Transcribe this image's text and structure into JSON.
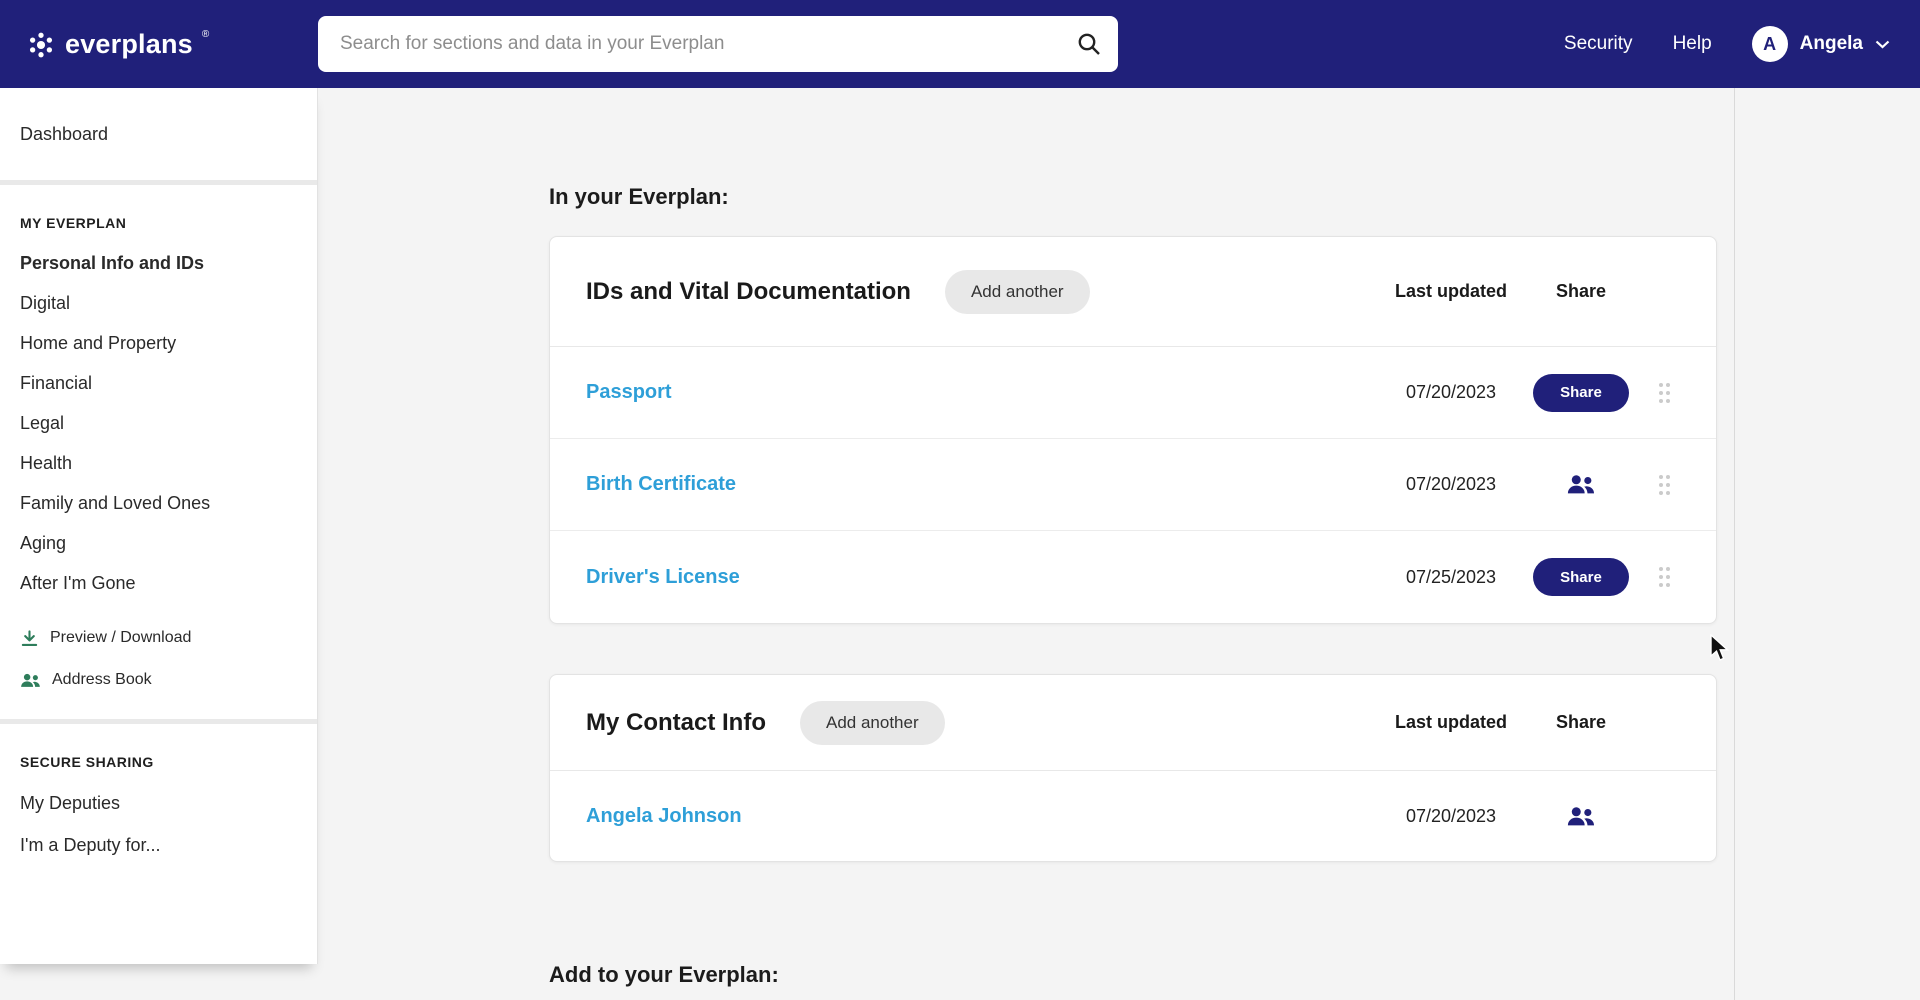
{
  "colors": {
    "navy": "#20207a",
    "link_blue": "#2e9fd8",
    "icon_green": "#2e7d5b",
    "background": "#f4f4f4"
  },
  "topbar": {
    "logo_text": "everplans",
    "registered_mark": "®",
    "search_placeholder": "Search for sections and data in your Everplan",
    "security_link": "Security",
    "help_link": "Help",
    "user_initial": "A",
    "user_name": "Angela"
  },
  "sidebar": {
    "dashboard": "Dashboard",
    "my_everplan_header": "MY EVERPLAN",
    "items": [
      "Personal Info and IDs",
      "Digital",
      "Home and Property",
      "Financial",
      "Legal",
      "Health",
      "Family and Loved Ones",
      "Aging",
      "After I'm Gone"
    ],
    "preview_download": "Preview / Download",
    "address_book": "Address Book",
    "secure_sharing_header": "SECURE SHARING",
    "my_deputies": "My Deputies",
    "im_a_deputy": "I'm a Deputy for..."
  },
  "main": {
    "heading_in": "In your Everplan:",
    "heading_add": "Add to your Everplan:",
    "cards": [
      {
        "title": "IDs and Vital Documentation",
        "add_button": "Add another",
        "last_updated_col": "Last updated",
        "share_col": "Share",
        "rows": [
          {
            "name": "Passport",
            "date": "07/20/2023",
            "share_label": "Share"
          },
          {
            "name": "Birth Certificate",
            "date": "07/20/2023"
          },
          {
            "name": "Driver's License",
            "date": "07/25/2023",
            "share_label": "Share"
          }
        ]
      },
      {
        "title": "My Contact Info",
        "add_button": "Add another",
        "last_updated_col": "Last updated",
        "share_col": "Share",
        "rows": [
          {
            "name": "Angela Johnson",
            "date": "07/20/2023"
          }
        ]
      }
    ]
  }
}
